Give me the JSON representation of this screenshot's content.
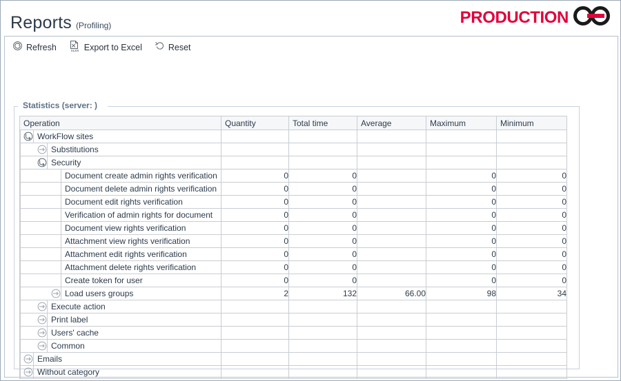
{
  "window": {
    "title": "Reports",
    "subtitle": "(Profiling)"
  },
  "brand": {
    "text": "PRODUCTION",
    "accent_color": "#e1003c",
    "mark_color": "#1a1a1a",
    "mark_name": "interlocking-rings-logo"
  },
  "toolbar": {
    "refresh_label": "Refresh",
    "export_label": "Export to Excel",
    "export_icon_text": "XLSX",
    "reset_label": "Reset"
  },
  "groupbox": {
    "title": "Statistics (server: )"
  },
  "grid": {
    "columns": [
      "Operation",
      "Quantity",
      "Total time",
      "Average",
      "Maximum",
      "Minimum"
    ],
    "rows": [
      {
        "level": 0,
        "toggle": "expanded",
        "label": "WorkFlow sites",
        "quantity": "",
        "total": "",
        "average": "",
        "maximum": "",
        "minimum": ""
      },
      {
        "level": 1,
        "toggle": "collapsed",
        "label": "Substitutions",
        "quantity": "",
        "total": "",
        "average": "",
        "maximum": "",
        "minimum": ""
      },
      {
        "level": 1,
        "toggle": "expanded",
        "label": "Security",
        "quantity": "",
        "total": "",
        "average": "",
        "maximum": "",
        "minimum": ""
      },
      {
        "level": 2,
        "toggle": "none",
        "label": "Document create admin rights verification",
        "quantity": "0",
        "total": "0",
        "average": "",
        "maximum": "0",
        "minimum": "0"
      },
      {
        "level": 2,
        "toggle": "none",
        "label": "Document delete admin rights verification",
        "quantity": "0",
        "total": "0",
        "average": "",
        "maximum": "0",
        "minimum": "0"
      },
      {
        "level": 2,
        "toggle": "none",
        "label": "Document edit rights verification",
        "quantity": "0",
        "total": "0",
        "average": "",
        "maximum": "0",
        "minimum": "0"
      },
      {
        "level": 2,
        "toggle": "none",
        "label": "Verification of admin rights for document",
        "quantity": "0",
        "total": "0",
        "average": "",
        "maximum": "0",
        "minimum": "0"
      },
      {
        "level": 2,
        "toggle": "none",
        "label": "Document view rights verification",
        "quantity": "0",
        "total": "0",
        "average": "",
        "maximum": "0",
        "minimum": "0"
      },
      {
        "level": 2,
        "toggle": "none",
        "label": "Attachment view rights verification",
        "quantity": "0",
        "total": "0",
        "average": "",
        "maximum": "0",
        "minimum": "0"
      },
      {
        "level": 2,
        "toggle": "none",
        "label": "Attachment edit rights verification",
        "quantity": "0",
        "total": "0",
        "average": "",
        "maximum": "0",
        "minimum": "0"
      },
      {
        "level": 2,
        "toggle": "none",
        "label": "Attachment delete rights verification",
        "quantity": "0",
        "total": "0",
        "average": "",
        "maximum": "0",
        "minimum": "0"
      },
      {
        "level": 2,
        "toggle": "none",
        "label": "Create token for user",
        "quantity": "0",
        "total": "0",
        "average": "",
        "maximum": "0",
        "minimum": "0"
      },
      {
        "level": 2,
        "toggle": "collapsed",
        "label": "Load users groups",
        "quantity": "2",
        "total": "132",
        "average": "66.00",
        "maximum": "98",
        "minimum": "34"
      },
      {
        "level": 1,
        "toggle": "collapsed",
        "label": "Execute action",
        "quantity": "",
        "total": "",
        "average": "",
        "maximum": "",
        "minimum": ""
      },
      {
        "level": 1,
        "toggle": "collapsed",
        "label": "Print label",
        "quantity": "",
        "total": "",
        "average": "",
        "maximum": "",
        "minimum": ""
      },
      {
        "level": 1,
        "toggle": "collapsed",
        "label": "Users' cache",
        "quantity": "",
        "total": "",
        "average": "",
        "maximum": "",
        "minimum": ""
      },
      {
        "level": 1,
        "toggle": "collapsed",
        "label": "Common",
        "quantity": "",
        "total": "",
        "average": "",
        "maximum": "",
        "minimum": ""
      },
      {
        "level": 0,
        "toggle": "collapsed",
        "label": "Emails",
        "quantity": "",
        "total": "",
        "average": "",
        "maximum": "",
        "minimum": ""
      },
      {
        "level": 0,
        "toggle": "collapsed",
        "label": "Without category",
        "quantity": "",
        "total": "",
        "average": "",
        "maximum": "",
        "minimum": ""
      }
    ]
  }
}
